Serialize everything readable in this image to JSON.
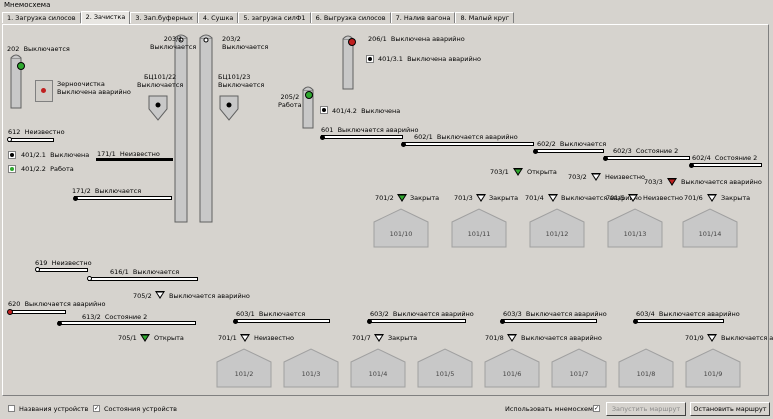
{
  "window_title": "Мнемосхема",
  "tabs": [
    {
      "label": "1. Загрузка силосов",
      "active": false
    },
    {
      "label": "2. Зачистка",
      "active": true
    },
    {
      "label": "3. Зап.буферных",
      "active": false
    },
    {
      "label": "4. Сушка",
      "active": false
    },
    {
      "label": "5. загрузка силФ1",
      "active": false
    },
    {
      "label": "6. Выгрузка силосов",
      "active": false
    },
    {
      "label": "7. Налив вагона",
      "active": false
    },
    {
      "label": "8. Малый круг",
      "active": false
    }
  ],
  "devices": {
    "d202": {
      "name": "202",
      "state": "Выключается"
    },
    "zernoochistka": {
      "name": "Зерноочистка",
      "state": "Выключена аварийно"
    },
    "d203_1": {
      "name": "203/1",
      "state": "Выключается"
    },
    "d203_2": {
      "name": "203/2",
      "state": "Выключается"
    },
    "bu101_22": {
      "name": "БЦ101/22",
      "state": "Выключается"
    },
    "bu101_23": {
      "name": "БЦ101/23",
      "state": "Выключается"
    },
    "d206_1": {
      "name": "206/1",
      "state": "Выключена аварийно"
    },
    "d401_3_1": {
      "name": "401/3.1",
      "state": "Выключена аварийно"
    },
    "d205_2": {
      "name": "205/2",
      "state": "Работа"
    },
    "d401_4_2": {
      "name": "401/4.2",
      "state": "Выключена"
    },
    "d612": {
      "name": "612",
      "state": "Неизвестно"
    },
    "d401_2_1": {
      "name": "401/2.1",
      "state": "Выключена"
    },
    "d401_2_2": {
      "name": "401/2.2",
      "state": "Работа"
    },
    "d171_1": {
      "name": "171/1",
      "state": "Неизвестно"
    },
    "d171_2": {
      "name": "171/2",
      "state": "Выключается"
    },
    "d601": {
      "name": "601",
      "state": "Выключается аварийно"
    },
    "d602_1": {
      "name": "602/1",
      "state": "Выключается аварийно"
    },
    "d602_2": {
      "name": "602/2",
      "state": "Выключается"
    },
    "d602_3": {
      "name": "602/3",
      "state": "Состояние 2"
    },
    "d602_4": {
      "name": "602/4",
      "state": "Состояние 2"
    },
    "d703_1": {
      "name": "703/1",
      "state": "Открыта"
    },
    "d703_2": {
      "name": "703/2",
      "state": "Неизвестно"
    },
    "d703_3": {
      "name": "703/3",
      "state": "Выключается аварийно"
    },
    "d701_2": {
      "name": "701/2",
      "state": "Закрыта"
    },
    "d701_3": {
      "name": "701/3",
      "state": "Закрыта"
    },
    "d701_4": {
      "name": "701/4",
      "state": "Выключается аварийно"
    },
    "d701_5": {
      "name": "701/5",
      "state": "Неизвестно"
    },
    "d701_6": {
      "name": "701/6",
      "state": "Закрыта"
    },
    "d619": {
      "name": "619",
      "state": "Неизвестно"
    },
    "d616_1": {
      "name": "616/1",
      "state": "Выключается"
    },
    "d705_2": {
      "name": "705/2",
      "state": "Выключается аварийно"
    },
    "d620": {
      "name": "620",
      "state": "Выключается аварийно"
    },
    "d613_2": {
      "name": "613/2",
      "state": "Состояние 2"
    },
    "d705_1": {
      "name": "705/1",
      "state": "Открыта"
    },
    "d603_1": {
      "name": "603/1",
      "state": "Выключается"
    },
    "d603_2": {
      "name": "603/2",
      "state": "Выключается аварийно"
    },
    "d603_3": {
      "name": "603/3",
      "state": "Выключается аварийно"
    },
    "d603_4": {
      "name": "603/4",
      "state": "Выключается аварийно"
    },
    "d701_1": {
      "name": "701/1",
      "state": "Неизвестно"
    },
    "d701_7": {
      "name": "701/7",
      "state": "Закрыта"
    },
    "d701_8": {
      "name": "701/8",
      "state": "Выключается аварийно"
    },
    "d701_9": {
      "name": "701/9",
      "state": "Выключается аварийно"
    }
  },
  "silos_top": [
    "101/10",
    "101/11",
    "101/12",
    "101/13",
    "101/14"
  ],
  "silos_bottom": [
    "101/2",
    "101/3",
    "101/4",
    "101/5",
    "101/6",
    "101/7",
    "101/8",
    "101/9"
  ],
  "bottom_bar": {
    "cb_names": {
      "label": "Названия устройств",
      "checked": false
    },
    "cb_states": {
      "label": "Состояния устройств",
      "checked": true
    },
    "cb_mnemo": {
      "label": "Использовать мнемосхемы",
      "checked": true
    },
    "btn_start": "Запустить маршрут",
    "btn_stop": "Остановить маршрут"
  },
  "colors": {
    "background": "#d6d3ce",
    "status_red": "#c02020",
    "status_green": "#2fa82f",
    "silo_fill": "#c8c8c8"
  }
}
